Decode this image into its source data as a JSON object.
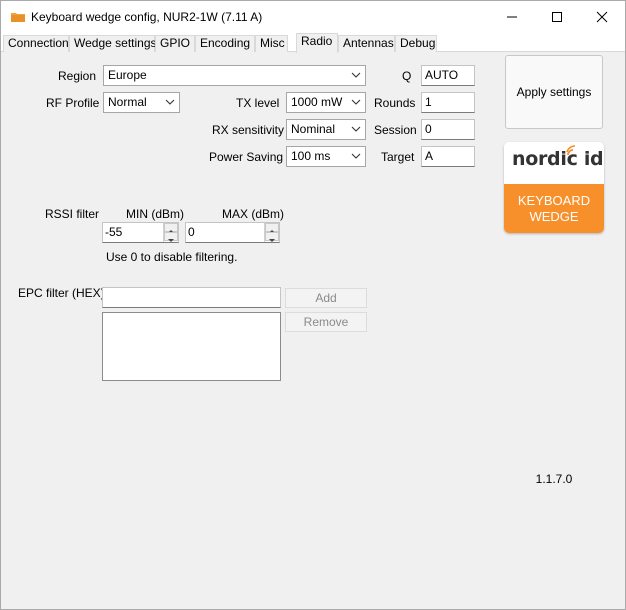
{
  "window": {
    "title": "Keyboard wedge config, NUR2-1W  (7.11 A)"
  },
  "tabs": [
    {
      "label": "Connection"
    },
    {
      "label": "Wedge settings"
    },
    {
      "label": "GPIO"
    },
    {
      "label": "Encoding"
    },
    {
      "label": "Misc"
    },
    {
      "label": "Radio",
      "active": true
    },
    {
      "label": "Antennas"
    },
    {
      "label": "Debug"
    }
  ],
  "radio": {
    "region": {
      "label": "Region",
      "value": "Europe"
    },
    "rf_profile": {
      "label": "RF Profile",
      "value": "Normal"
    },
    "tx_level": {
      "label": "TX level",
      "value": "1000 mW"
    },
    "rx_sensitivity": {
      "label": "RX sensitivity",
      "value": "Nominal"
    },
    "power_saving": {
      "label": "Power Saving",
      "value": "100 ms"
    },
    "q": {
      "label": "Q",
      "value": "AUTO"
    },
    "rounds": {
      "label": "Rounds",
      "value": "1"
    },
    "session": {
      "label": "Session",
      "value": "0"
    },
    "target": {
      "label": "Target",
      "value": "A"
    }
  },
  "rssi": {
    "label": "RSSI filter",
    "min_label": "MIN (dBm)",
    "max_label": "MAX (dBm)",
    "min_value": "-55",
    "max_value": "0",
    "hint": "Use 0 to disable filtering."
  },
  "epc": {
    "label": "EPC filter (HEX)",
    "input_value": "",
    "add_label": "Add",
    "remove_label": "Remove",
    "items": []
  },
  "side": {
    "apply_label": "Apply settings",
    "logo_brand": "nordic id",
    "logo_line1": "KEYBOARD",
    "logo_line2": "WEDGE",
    "version": "1.1.7.0"
  },
  "colors": {
    "logo_orange": "#f7902b",
    "app_icon": "#f2a33a"
  }
}
